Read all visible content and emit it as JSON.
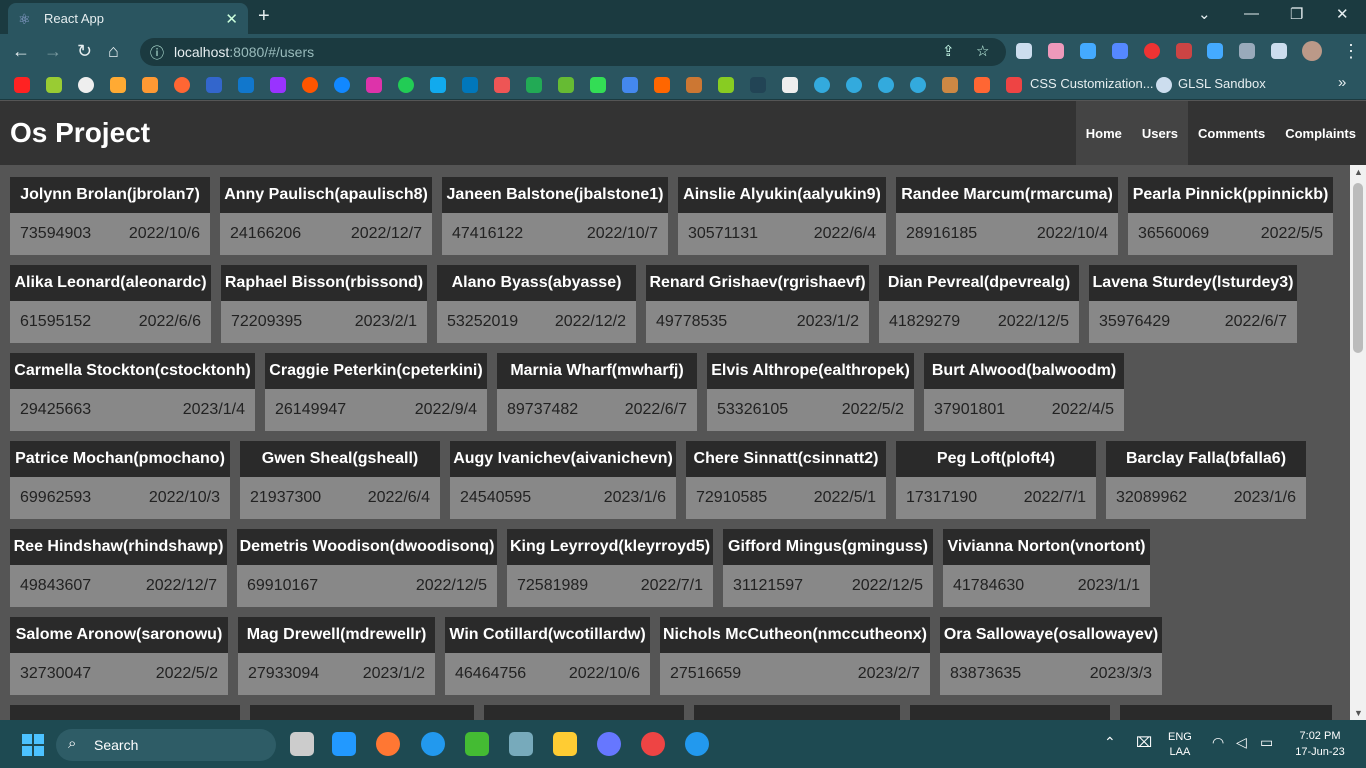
{
  "browser": {
    "tab_title": "React App",
    "url_host": "localhost",
    "url_rest": ":8080/#/users",
    "bookmarks": [
      {
        "label": "CSS Customization...",
        "icon": "bookmark-icon"
      },
      {
        "label": "GLSL Sandbox",
        "icon": "globe-icon"
      }
    ]
  },
  "app": {
    "brand": "Os Project",
    "nav": [
      {
        "label": "Home"
      },
      {
        "label": "Users"
      },
      {
        "label": "Comments"
      },
      {
        "label": "Complaints"
      }
    ],
    "users": [
      {
        "name": "Jolynn Brolan(jbrolan7)",
        "id": "73594903",
        "date": "2022/10/6"
      },
      {
        "name": "Anny Paulisch(apaulisch8)",
        "id": "24166206",
        "date": "2022/12/7"
      },
      {
        "name": "Janeen Balstone(jbalstone1)",
        "id": "47416122",
        "date": "2022/10/7"
      },
      {
        "name": "Ainslie Alyukin(aalyukin9)",
        "id": "30571131",
        "date": "2022/6/4"
      },
      {
        "name": "Randee Marcum(rmarcuma)",
        "id": "28916185",
        "date": "2022/10/4"
      },
      {
        "name": "Pearla Pinnick(ppinnickb)",
        "id": "36560069",
        "date": "2022/5/5"
      },
      {
        "name": "Alika Leonard(aleonardc)",
        "id": "61595152",
        "date": "2022/6/6"
      },
      {
        "name": "Raphael Bisson(rbissond)",
        "id": "72209395",
        "date": "2023/2/1"
      },
      {
        "name": "Alano Byass(abyasse)",
        "id": "53252019",
        "date": "2022/12/2"
      },
      {
        "name": "Renard Grishaev(rgrishaevf)",
        "id": "49778535",
        "date": "2023/1/2"
      },
      {
        "name": "Dian Pevreal(dpevrealg)",
        "id": "41829279",
        "date": "2022/12/5"
      },
      {
        "name": "Lavena Sturdey(lsturdey3)",
        "id": "35976429",
        "date": "2022/6/7"
      },
      {
        "name": "Carmella Stockton(cstocktonh)",
        "id": "29425663",
        "date": "2023/1/4"
      },
      {
        "name": "Craggie Peterkin(cpeterkini)",
        "id": "26149947",
        "date": "2022/9/4"
      },
      {
        "name": "Marnia Wharf(mwharfj)",
        "id": "89737482",
        "date": "2022/6/7"
      },
      {
        "name": "Elvis Althrope(ealthropek)",
        "id": "53326105",
        "date": "2022/5/2"
      },
      {
        "name": "Burt Alwood(balwoodm)",
        "id": "37901801",
        "date": "2022/4/5"
      },
      {
        "name": "Patrice Mochan(pmochano)",
        "id": "69962593",
        "date": "2022/10/3"
      },
      {
        "name": "Gwen Sheal(gsheall)",
        "id": "21937300",
        "date": "2022/6/4"
      },
      {
        "name": "Augy Ivanichev(aivanichevn)",
        "id": "24540595",
        "date": "2023/1/6"
      },
      {
        "name": "Chere Sinnatt(csinnatt2)",
        "id": "72910585",
        "date": "2022/5/1"
      },
      {
        "name": "Peg Loft(ploft4)",
        "id": "17317190",
        "date": "2022/7/1"
      },
      {
        "name": "Barclay Falla(bfalla6)",
        "id": "32089962",
        "date": "2023/1/6"
      },
      {
        "name": "Ree Hindshaw(rhindshawp)",
        "id": "49843607",
        "date": "2022/12/7"
      },
      {
        "name": "Demetris Woodison(dwoodisonq)",
        "id": "69910167",
        "date": "2022/12/5"
      },
      {
        "name": "King Leyrroyd(kleyrroyd5)",
        "id": "72581989",
        "date": "2022/7/1"
      },
      {
        "name": "Gifford Mingus(gminguss)",
        "id": "31121597",
        "date": "2022/12/5"
      },
      {
        "name": "Vivianna Norton(vnortont)",
        "id": "41784630",
        "date": "2023/1/1"
      },
      {
        "name": "Salome Aronow(saronowu)",
        "id": "32730047",
        "date": "2022/5/2"
      },
      {
        "name": "Mag Drewell(mdrewellr)",
        "id": "27933094",
        "date": "2023/1/2"
      },
      {
        "name": "Win Cotillard(wcotillardw)",
        "id": "46464756",
        "date": "2022/10/6"
      },
      {
        "name": "Nichols McCutheon(nmccutheonx)",
        "id": "27516659",
        "date": "2023/2/7"
      },
      {
        "name": "Ora Sallowaye(osallowayev)",
        "id": "83873635",
        "date": "2023/3/3"
      }
    ]
  },
  "taskbar": {
    "search_label": "Search",
    "lang_top": "ENG",
    "lang_bottom": "LAA",
    "time": "7:02 PM",
    "date": "17-Jun-23"
  }
}
